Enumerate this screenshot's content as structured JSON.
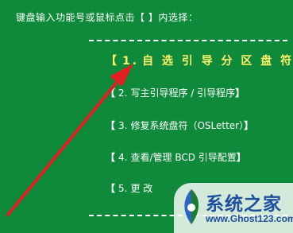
{
  "prompt": "键盘输入功能号或鼠标点击【 】内选择：",
  "menu": {
    "items": [
      {
        "bracket_open": "【",
        "number": "1.",
        "label": "自 选 引 导 分 区 盘 符",
        "bracket_close": "】",
        "selected": true
      },
      {
        "bracket_open": "【",
        "number": "2.",
        "label": "写主引导程序 / 引导程序",
        "bracket_close": "】"
      },
      {
        "bracket_open": "【",
        "number": "3.",
        "label": "修复系统盘符（OSLetter）",
        "bracket_close": "】"
      },
      {
        "bracket_open": "【",
        "number": "4.",
        "label": "查看/管理 BCD 引导配置",
        "bracket_close": "】"
      },
      {
        "bracket_open": "【",
        "number": "5.",
        "label": "更 改",
        "bracket_close": ""
      }
    ]
  },
  "watermark": {
    "title": "系统之家",
    "url": "www.Ghost123.com"
  },
  "colors": {
    "background": "#0f8a3a",
    "text": "#ffffff",
    "selected_text": "#fff36a",
    "arrow": "#e02020",
    "watermark_blue": "#1e4f9e"
  },
  "icons": {
    "arrow": "red-arrow-icon",
    "logo": "system-home-logo-icon"
  }
}
